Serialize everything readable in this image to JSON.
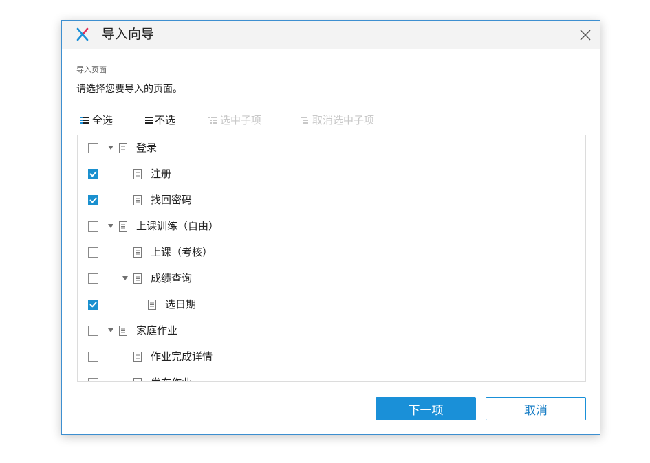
{
  "dialog": {
    "title": "导入向导",
    "close_icon": "close-icon",
    "logo_icon": "axure-x-logo-icon"
  },
  "section": {
    "label": "导入页面",
    "instruction": "请选择您要导入的页面。"
  },
  "toolbar": {
    "select_all": "全选",
    "select_none": "不选",
    "select_children": "选中子项",
    "deselect_children": "取消选中子项"
  },
  "tree": {
    "items": [
      {
        "label": "登录",
        "checked": false,
        "expandable": true,
        "level": 0
      },
      {
        "label": "注册",
        "checked": true,
        "expandable": false,
        "level": 1
      },
      {
        "label": "找回密码",
        "checked": true,
        "expandable": false,
        "level": 1
      },
      {
        "label": "上课训练（自由）",
        "checked": false,
        "expandable": true,
        "level": 0
      },
      {
        "label": "上课（考核）",
        "checked": false,
        "expandable": false,
        "level": 1
      },
      {
        "label": "成绩查询",
        "checked": false,
        "expandable": true,
        "level": 1
      },
      {
        "label": "选日期",
        "checked": true,
        "expandable": false,
        "level": 2
      },
      {
        "label": "家庭作业",
        "checked": false,
        "expandable": true,
        "level": 0
      },
      {
        "label": "作业完成详情",
        "checked": false,
        "expandable": false,
        "level": 1
      },
      {
        "label": "发布作业",
        "checked": false,
        "expandable": true,
        "level": 1
      }
    ]
  },
  "buttons": {
    "next": "下一项",
    "cancel": "取消"
  },
  "colors": {
    "accent": "#1a90d8",
    "checked": "#1a90cf",
    "border": "#3d8fd0",
    "titlebar": "#f3f3f3"
  }
}
